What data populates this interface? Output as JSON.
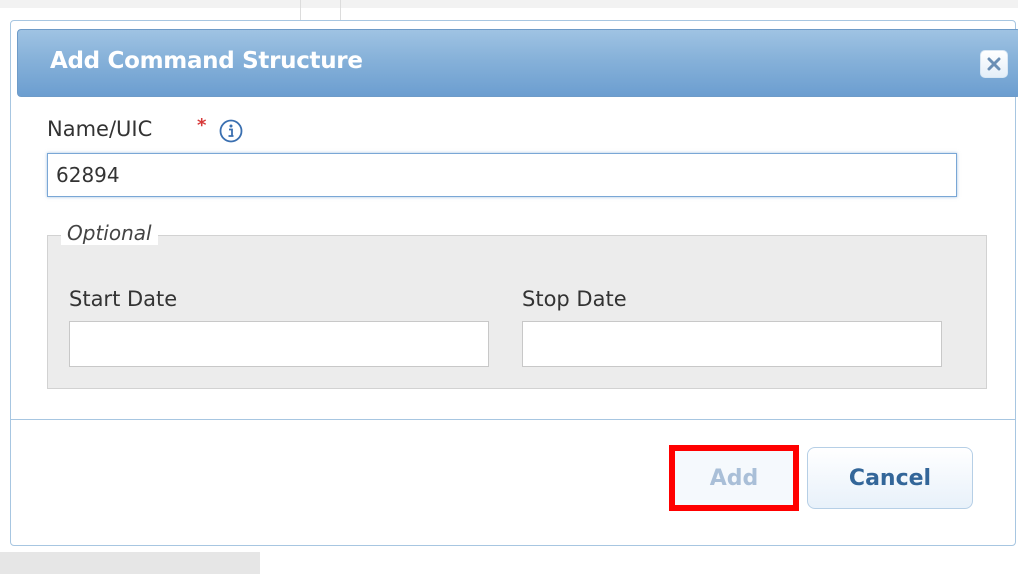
{
  "dialog": {
    "title": "Add Command Structure",
    "close_icon": "close-icon"
  },
  "form": {
    "name_label": "Name/UIC",
    "required_marker": "*",
    "info_icon": "info-icon",
    "name_value": "62894",
    "optional_legend": "Optional",
    "start_date_label": "Start Date",
    "start_date_value": "",
    "stop_date_label": "Stop Date",
    "stop_date_value": ""
  },
  "buttons": {
    "add_label": "Add",
    "cancel_label": "Cancel"
  },
  "colors": {
    "title_bar": "#86b1d9",
    "highlight": "#ff0000",
    "required": "#d73a3a",
    "button_text": "#336699"
  }
}
